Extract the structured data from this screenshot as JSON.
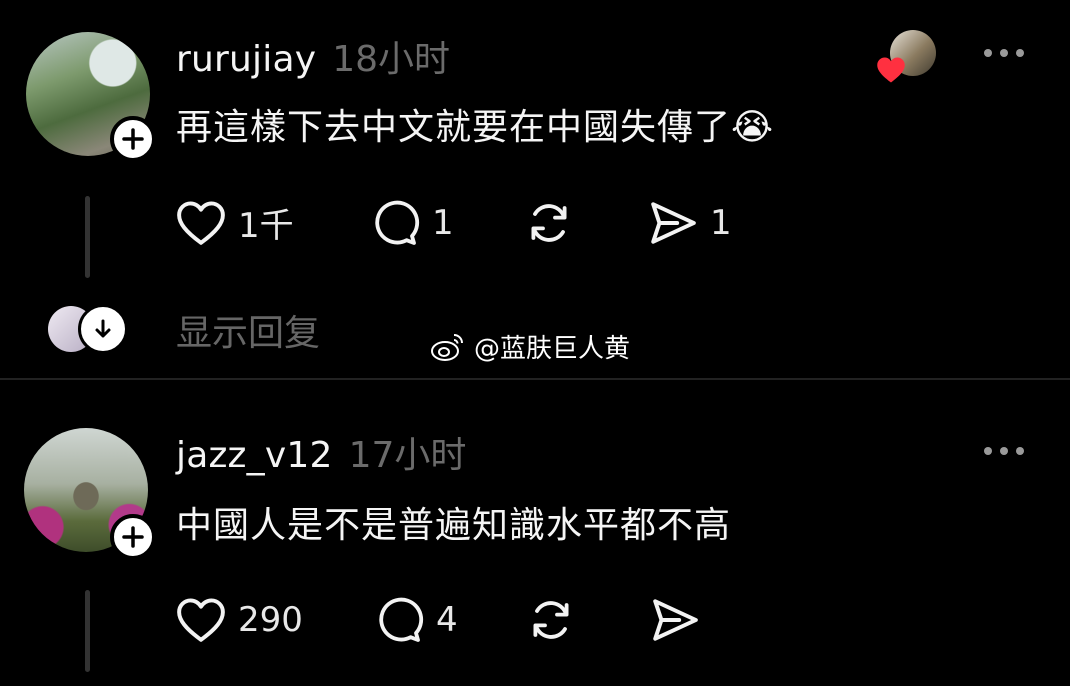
{
  "posts": [
    {
      "username": "rurujiay",
      "time": "18小时",
      "text": "再這樣下去中文就要在中國失傳了😭",
      "likes": "1千",
      "comments": "1",
      "shares": "1"
    },
    {
      "username": "jazz_v12",
      "time": "17小时",
      "text": "中國人是不是普遍知識水平都不高",
      "likes": "290",
      "comments": "4"
    }
  ],
  "show_replies_label": "显示回复",
  "watermark": "@蓝肤巨人黄",
  "icons": [
    "plus-icon",
    "heart-icon",
    "comment-icon",
    "repost-icon",
    "share-icon",
    "more-icon",
    "arrow-down-icon",
    "weibo-icon"
  ],
  "colors": {
    "background": "#000000",
    "text": "#f5f5f5",
    "muted": "#6b6b6b",
    "like_badge": "#ff3040"
  }
}
